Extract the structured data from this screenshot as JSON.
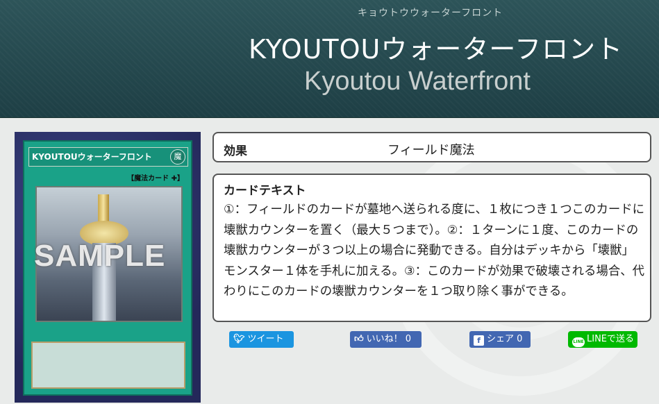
{
  "header": {
    "ruby": "キョウトウウォーターフロント",
    "title_ja": "KYOUTOUウォーターフロント",
    "title_en": "Kyoutou Waterfront"
  },
  "card_image": {
    "name": "KYOUTOUウォーターフロント",
    "attribute": "魔",
    "type": "【魔法カード",
    "watermark": "SAMPLE"
  },
  "effect": {
    "label": "効果",
    "value": "フィールド魔法"
  },
  "card_text": {
    "label": "カードテキスト",
    "body": "①：フィールドのカードが墓地へ送られる度に、１枚につき１つこのカードに壊獣カウンターを置く（最大５つまで）。②：１ターンに１度、このカードの壊獣カウンターが３つ以上の場合に発動できる。自分はデッキから「壊獣」モンスター１体を手札に加える。③：このカードが効果で破壊される場合、代わりにこのカードの壊獣カウンターを１つ取り除く事ができる。"
  },
  "share": {
    "tweet": "ツイート",
    "like": "いいね！ 0",
    "fb_share": "シェア 0",
    "line": "LINEで送る"
  },
  "colors": {
    "header_bg": "#2c5257",
    "twitter": "#1b95e0",
    "facebook": "#4267b2",
    "line": "#00b900"
  },
  "icons": [
    "twitter-icon",
    "thumbs-up-icon",
    "facebook-icon",
    "line-icon"
  ]
}
